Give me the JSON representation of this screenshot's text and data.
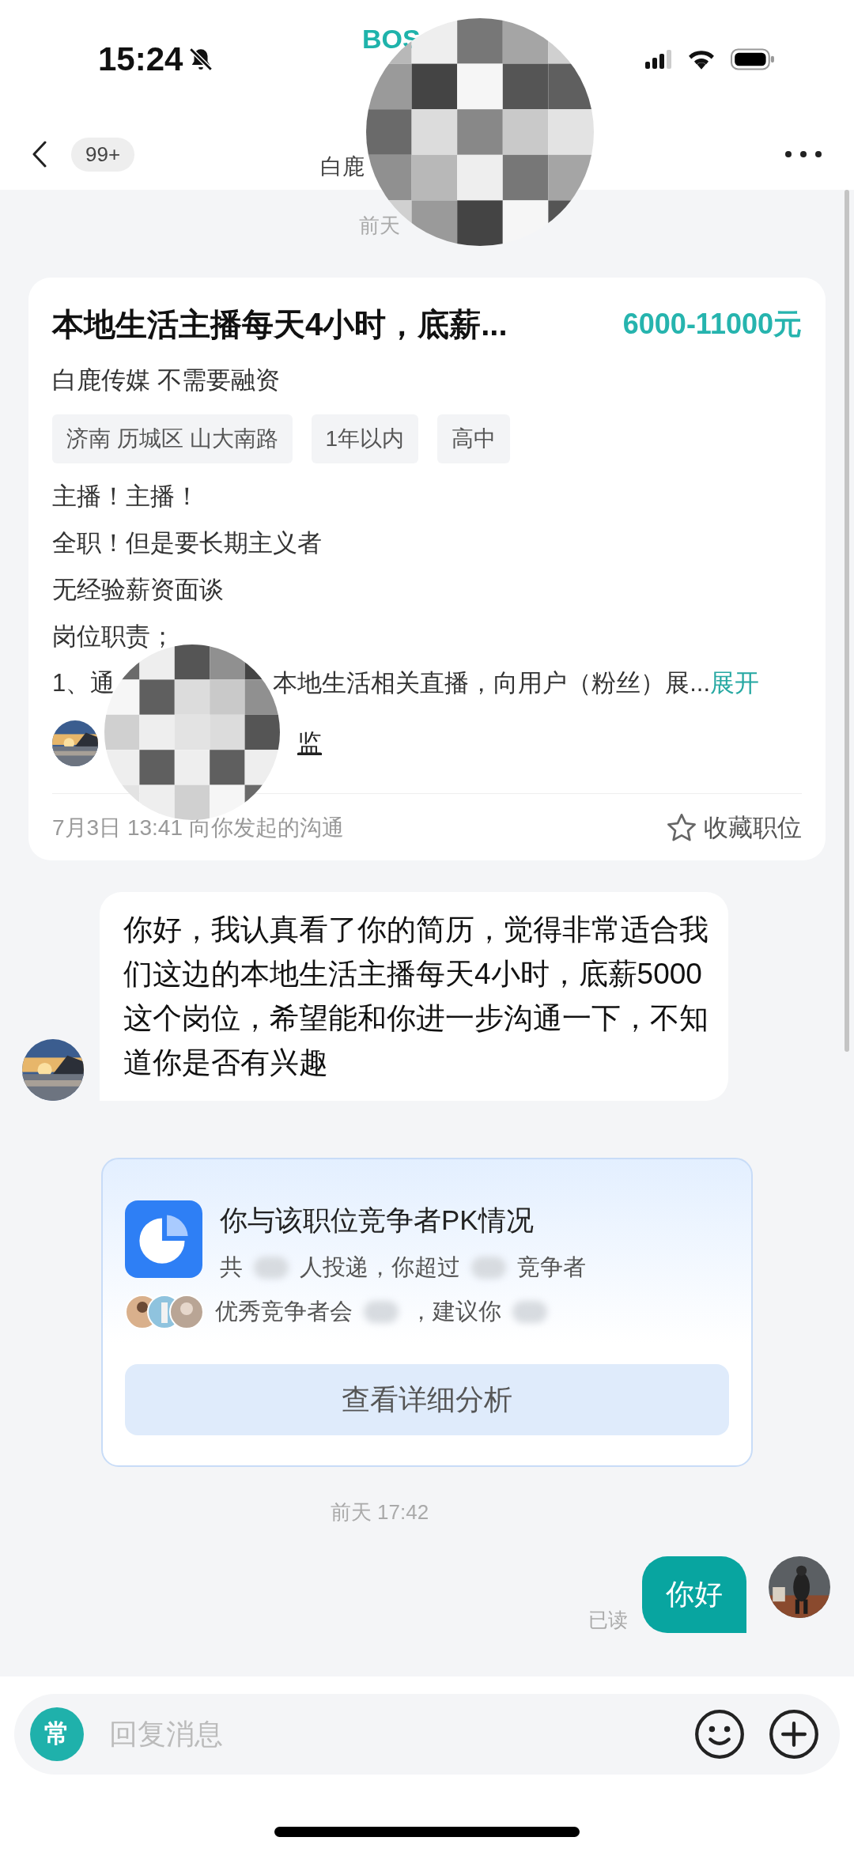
{
  "status_bar": {
    "time": "15:24",
    "app_label": "BOS"
  },
  "header": {
    "badge": "99+",
    "title": "白鹿"
  },
  "first_timestamp": "前天",
  "job_card": {
    "title": "本地生活主播每天4小时，底薪...",
    "salary": "6000-11000元",
    "company": "白鹿传媒 不需要融资",
    "tags": [
      "济南 历城区 山大南路",
      "1年以内",
      "高中"
    ],
    "description": [
      "主播！主播！",
      "全职！但是要长期主义者",
      "无经验薪资面谈",
      "岗位职责；"
    ],
    "last_line_start": "1、通",
    "last_line_end": "本地生活相关直播，向用户（粉丝）展...",
    "expand": "展开",
    "recruiter": "监",
    "footer": "7月3日 13:41 向你发起的沟通",
    "favorite": "收藏职位"
  },
  "received_message": {
    "text": "你好，我认真看了你的简历，觉得非常适合我们这边的本地生活主播每天4小时，底薪5000这个岗位，希望能和你进一步沟通一下，不知道你是否有兴趣"
  },
  "pk_card": {
    "title": "你与该职位竞争者PK情况",
    "line_1": [
      "共",
      "人投递，你超过",
      "竞争者"
    ],
    "line_2": [
      "优秀竞争者会",
      "，建议你"
    ],
    "button": "查看详细分析"
  },
  "second_timestamp": "前天 17:42",
  "sent_message": {
    "text": "你好",
    "status": "已读"
  },
  "input_bar": {
    "quick_label": "常",
    "placeholder": "回复消息"
  }
}
